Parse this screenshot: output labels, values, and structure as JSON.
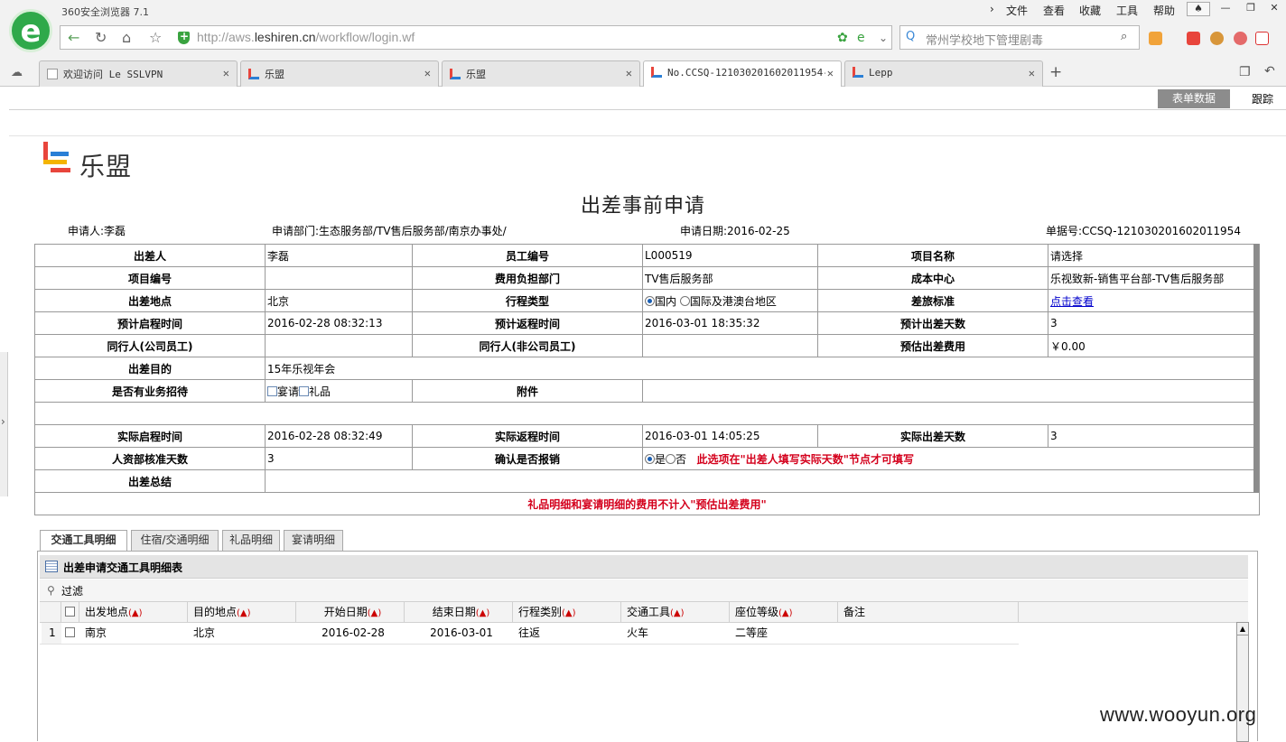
{
  "browser": {
    "app_title": "360安全浏览器 7.1",
    "menus": [
      "文件",
      "查看",
      "收藏",
      "工具",
      "帮助"
    ],
    "url_prefix": "http://aws.",
    "url_domain": "leshiren.cn",
    "url_path": "/workflow/login.wf",
    "search_query": "常州学校地下管埋剧毒",
    "tabs": [
      {
        "label": "欢迎访问 Le SSLVPN"
      },
      {
        "label": "乐盟"
      },
      {
        "label": "乐盟"
      },
      {
        "label": "No.CCSQ-121030201602011954-"
      },
      {
        "label": "Lepp"
      }
    ],
    "new_tab": "+"
  },
  "toolbar": {
    "form_data_label": "表单数据",
    "track_label": "跟踪"
  },
  "brand": {
    "name": "乐盟"
  },
  "form": {
    "title": "出差事前申请",
    "applicant": "申请人:李磊",
    "department": "申请部门:生态服务部/TV售后服务部/南京办事处/",
    "apply_date": "申请日期:2016-02-25",
    "doc_no": "单据号:CCSQ-121030201602011954",
    "fields": {
      "traveler_label": "出差人",
      "traveler": "李磊",
      "employee_no_label": "员工编号",
      "employee_no": "L000519",
      "project_name_label": "项目名称",
      "project_name": "请选择",
      "project_no_label": "项目编号",
      "project_no": "",
      "cost_dept_label": "费用负担部门",
      "cost_dept": "TV售后服务部",
      "cost_center_label": "成本中心",
      "cost_center": "乐视致新-销售平台部-TV售后服务部",
      "location_label": "出差地点",
      "location": "北京",
      "trip_type_label": "行程类型",
      "trip_type_opt1": "国内",
      "trip_type_opt2": "国际及港澳台地区",
      "standard_label": "差旅标准",
      "standard_link": "点击查看",
      "plan_start_label": "预计启程时间",
      "plan_start": "2016-02-28 08:32:13",
      "plan_return_label": "预计返程时间",
      "plan_return": "2016-03-01 18:35:32",
      "plan_days_label": "预计出差天数",
      "plan_days": "3",
      "companion_inner_label": "同行人(公司员工)",
      "companion_inner": "",
      "companion_outer_label": "同行人(非公司员工)",
      "companion_outer": "",
      "est_cost_label": "预估出差费用",
      "est_cost": "￥0.00",
      "purpose_label": "出差目的",
      "purpose": "15年乐视年会",
      "hospitality_label": "是否有业务招待",
      "hosp_opt1": "宴请",
      "hosp_opt2": "礼品",
      "attachment_label": "附件",
      "actual_start_label": "实际启程时间",
      "actual_start": "2016-02-28 08:32:49",
      "actual_return_label": "实际返程时间",
      "actual_return": "2016-03-01 14:05:25",
      "actual_days_label": "实际出差天数",
      "actual_days": "3",
      "hr_days_label": "人资部核准天数",
      "hr_days": "3",
      "reimburse_label": "确认是否报销",
      "reimburse_yes": "是",
      "reimburse_no": "否",
      "reimburse_note": "此选项在\"出差人填写实际天数\"节点才可填写",
      "summary_label": "出差总结",
      "cost_note": "礼品明细和宴请明细的费用不计入\"预估出差费用\""
    }
  },
  "subtabs": [
    "交通工具明细",
    "住宿/交通明细",
    "礼品明细",
    "宴请明细"
  ],
  "grid": {
    "title": "出差申请交通工具明细表",
    "filter_label": "过滤",
    "columns": [
      "出发地点",
      "目的地点",
      "开始日期",
      "结束日期",
      "行程类别",
      "交通工具",
      "座位等级",
      "备注"
    ],
    "required_mark": "(▲)",
    "rows": [
      {
        "no": "1",
        "from": "南京",
        "to": "北京",
        "start": "2016-02-28",
        "end": "2016-03-01",
        "category": "往返",
        "vehicle": "火车",
        "seat": "二等座",
        "remark": ""
      }
    ]
  },
  "watermark": "www.wooyun.org",
  "colors": {
    "accent_red": "#d4001c",
    "logo_green": "#2fa94a",
    "link_blue": "#0000cc"
  }
}
